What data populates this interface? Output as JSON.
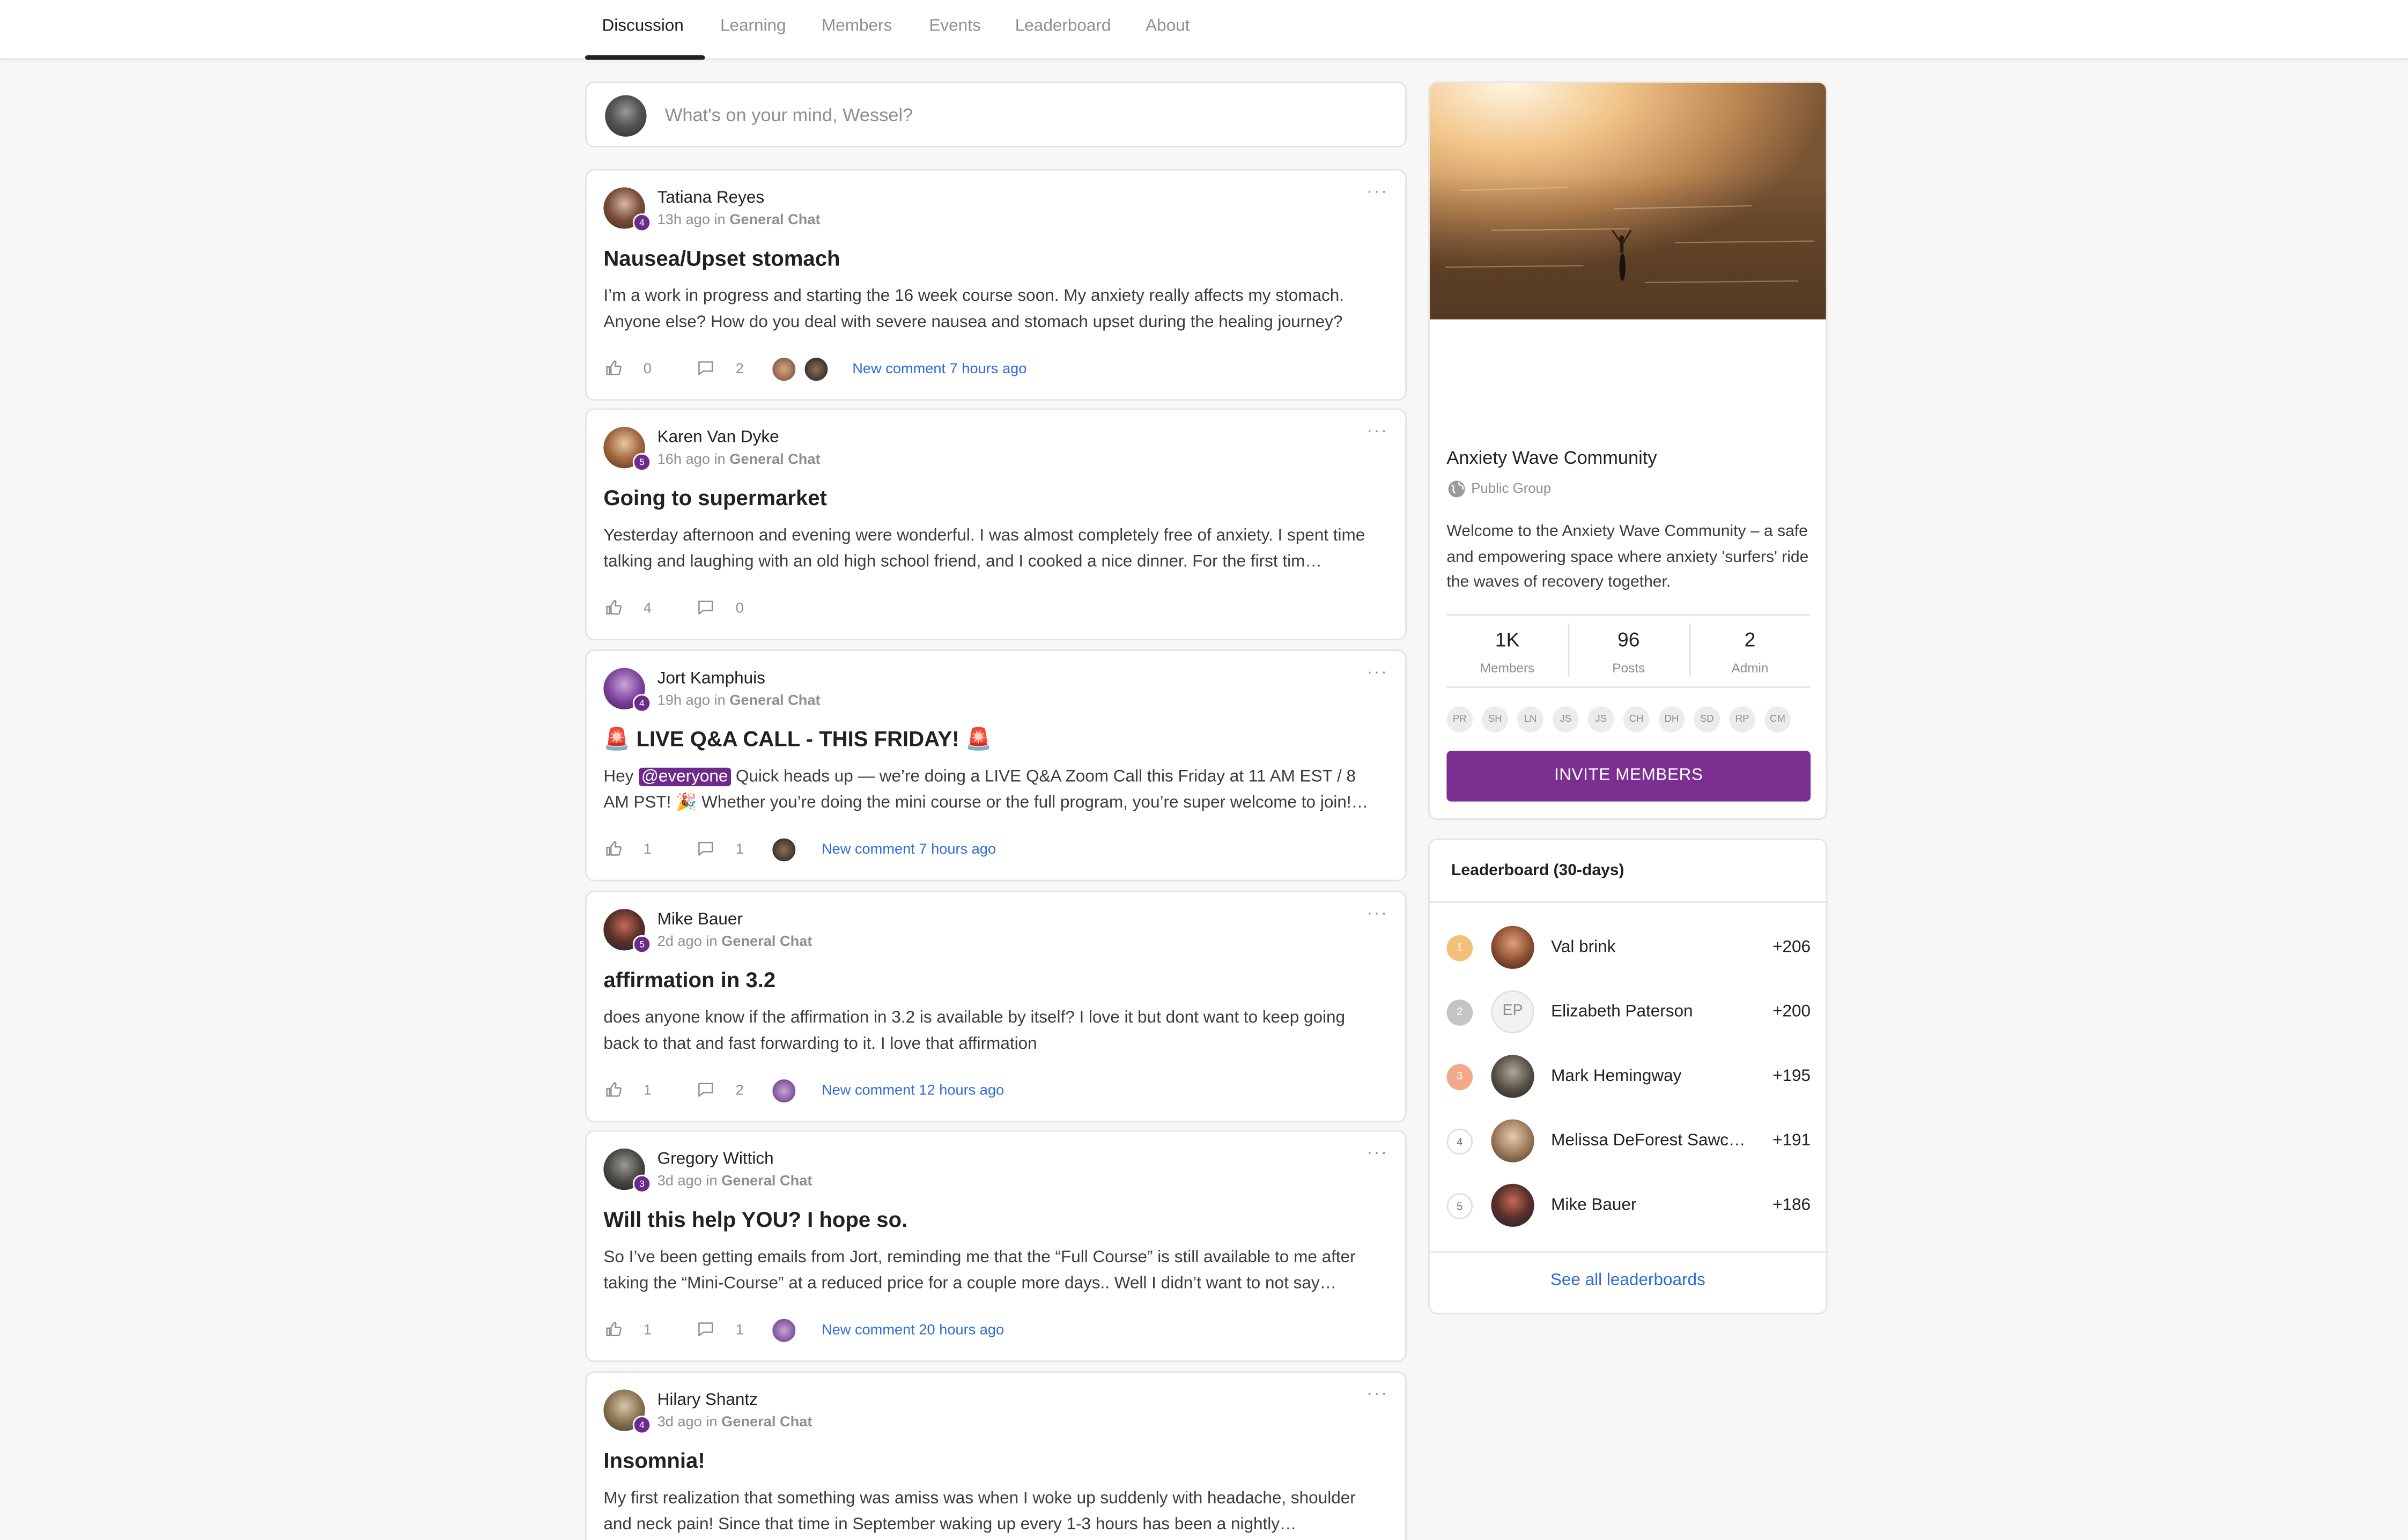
{
  "nav": {
    "tabs": [
      {
        "label": "Discussion"
      },
      {
        "label": "Learning"
      },
      {
        "label": "Members"
      },
      {
        "label": "Events"
      },
      {
        "label": "Leaderboard"
      },
      {
        "label": "About"
      }
    ]
  },
  "composer": {
    "placeholder": "What's on your mind, Wessel?"
  },
  "posts": [
    {
      "author": "Tatiana Reyes",
      "level": "4",
      "time": "13h ago",
      "in": "in",
      "category": "General Chat",
      "title": "Nausea/Upset stomach",
      "body": "I’m a work in progress and starting the 16 week course soon. My anxiety really affects my stomach. Anyone else? How do you deal with severe nausea and stomach upset during the healing journey?",
      "likes": "0",
      "comments": "2",
      "new_comment": "New comment 7 hours ago"
    },
    {
      "author": "Karen Van Dyke",
      "level": "5",
      "time": "16h ago",
      "in": "in",
      "category": "General Chat",
      "title": "Going to supermarket",
      "body": "Yesterday afternoon and evening were wonderful. I was almost completely free of anxiety. I spent time talking and laughing with an old high school friend, and I cooked a nice dinner. For the first tim…",
      "likes": "4",
      "comments": "0",
      "new_comment": ""
    },
    {
      "author": "Jort Kamphuis",
      "level": "4",
      "time": "19h ago",
      "in": "in",
      "category": "General Chat",
      "title": "🚨 LIVE Q&A CALL - THIS FRIDAY! 🚨",
      "body_prefix": "Hey ",
      "mention": "@everyone",
      "body": " Quick heads up — we’re doing a LIVE Q&A Zoom Call this Friday at 11 AM EST / 8 AM PST! 🎉 Whether you’re doing the mini course or the full program, you’re super welcome to join!…",
      "likes": "1",
      "comments": "1",
      "new_comment": "New comment 7 hours ago"
    },
    {
      "author": "Mike Bauer",
      "level": "5",
      "time": "2d ago",
      "in": "in",
      "category": "General Chat",
      "title": "affirmation in 3.2",
      "body": "does anyone know if the affirmation in 3.2 is available by itself? I love it but dont want to keep going back to that and fast forwarding to it. I love that affirmation",
      "likes": "1",
      "comments": "2",
      "new_comment": "New comment 12 hours ago"
    },
    {
      "author": "Gregory Wittich",
      "level": "3",
      "time": "3d ago",
      "in": "in",
      "category": "General Chat",
      "title": "Will this help YOU? I hope so.",
      "body": "So I’ve been getting emails from Jort, reminding me that the “Full Course” is still available to me after taking the “Mini-Course” at a reduced price for a couple more days.. Well I didn’t want to not say…",
      "likes": "1",
      "comments": "1",
      "new_comment": "New comment 20 hours ago"
    },
    {
      "author": "Hilary Shantz",
      "level": "4",
      "time": "3d ago",
      "in": "in",
      "category": "General Chat",
      "title": "Insomnia!",
      "body": "My first realization that something was amiss was when I woke up suddenly with headache, shoulder and neck pain! Since that time in September waking up every 1-3 hours has been a nightly…",
      "likes": "",
      "comments": "",
      "new_comment": ""
    }
  ],
  "group": {
    "name": "Anxiety Wave Community",
    "type": "Public Group",
    "description": "Welcome to the Anxiety Wave Community – a safe and empowering space where anxiety 'surfers' ride the waves of recovery together.",
    "stats": [
      {
        "value": "1K",
        "label": "Members"
      },
      {
        "value": "96",
        "label": "Posts"
      },
      {
        "value": "2",
        "label": "Admin"
      }
    ],
    "member_initials": [
      "PR",
      "SH",
      "LN",
      "JS",
      "JS",
      "CH",
      "DH",
      "SD",
      "RP",
      "CM"
    ],
    "invite_label": "INVITE MEMBERS",
    "accent_color": "#7b3091"
  },
  "leaderboard": {
    "title": "Leaderboard (30-days)",
    "rows": [
      {
        "rank": "1",
        "name": "Val brink",
        "points": "+206"
      },
      {
        "rank": "2",
        "name": "Elizabeth Paterson",
        "initials": "EP",
        "points": "+200"
      },
      {
        "rank": "3",
        "name": "Mark Hemingway",
        "points": "+195"
      },
      {
        "rank": "4",
        "name": "Melissa DeForest Sawczuk",
        "points": "+191"
      },
      {
        "rank": "5",
        "name": "Mike Bauer",
        "points": "+186"
      }
    ],
    "see_all": "See all leaderboards"
  }
}
